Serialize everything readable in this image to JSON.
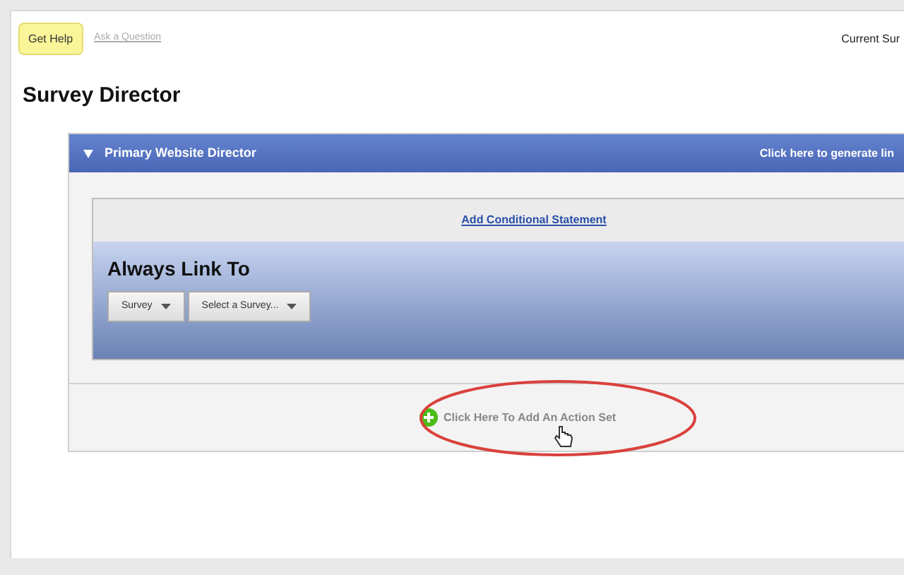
{
  "help_bar": {
    "button": "Get Help",
    "link": "Ask a Question",
    "current": "Current Sur"
  },
  "title": "Survey Director",
  "director": {
    "expanded": true,
    "name": "Primary Website Director",
    "generate_link": "Click here to generate lin",
    "add_condition": "Add Conditional Statement",
    "rule": {
      "heading": "Always Link To",
      "dropdowns": [
        "Survey",
        "Select a Survey..."
      ]
    },
    "add_action": "Click Here To Add An Action Set"
  }
}
